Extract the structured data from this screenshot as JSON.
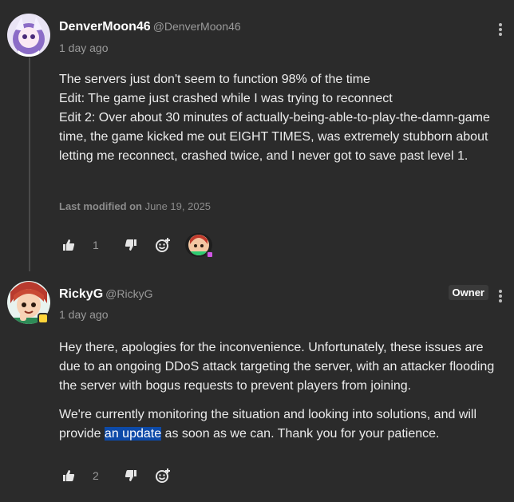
{
  "comments": [
    {
      "author": "DenverMoon46",
      "handle": "@DenverMoon46",
      "time": "1 day ago",
      "lines": [
        "The servers just don't seem to function 98% of the time",
        "Edit: The game just crashed while I was trying to reconnect",
        "Edit 2: Over about 30 minutes of actually-being-able-to-play-the-damn-game time, the game kicked me out EIGHT TIMES, was extremely stubborn about letting me reconnect, crashed twice, and I never got to save past level 1."
      ],
      "modified_label": "Last modified on",
      "modified_date": "June 19, 2025",
      "likes": "1"
    },
    {
      "author": "RickyG",
      "handle": "@RickyG",
      "badge": "Owner",
      "time": "1 day ago",
      "para1": "Hey there, apologies for the inconvenience. Unfortunately, these issues are due to an ongoing DDoS attack targeting the server, with an attacker flooding the server with bogus requests to prevent players from joining.",
      "para2_before": "We're currently monitoring the situation and looking into solutions, and will provide ",
      "para2_highlight": "an update",
      "para2_after": " as soon as we can. Thank you for your patience.",
      "likes": "2"
    }
  ],
  "icons": [
    "thumbs-up-icon",
    "thumbs-down-icon",
    "add-reaction-icon",
    "more-options-icon"
  ],
  "colors": {
    "background": "#2b2b2b",
    "highlight": "#0d4aa8",
    "muted": "#9a9a9a"
  }
}
